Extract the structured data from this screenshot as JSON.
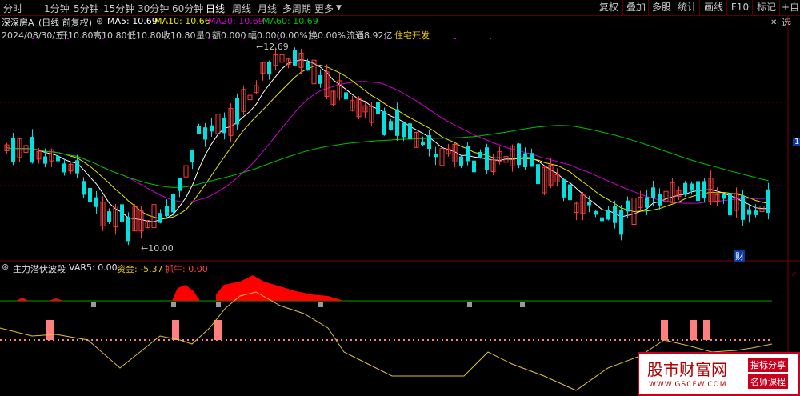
{
  "toolbar": {
    "periods": [
      "分时",
      "1分钟",
      "5分钟",
      "15分钟",
      "30分钟",
      "60分钟",
      "日线",
      "周线",
      "月线",
      "多周期",
      "更多"
    ],
    "active_period": "日线",
    "right_buttons": [
      "复权",
      "叠加",
      "多股",
      "统计",
      "画线",
      "F10",
      "标记"
    ],
    "extra_label": "+自选"
  },
  "stock": {
    "name": "深深房A",
    "mode": "(日线 前复权)",
    "date": "2024/08/30/五",
    "open": "开10.80",
    "high": "高10.80",
    "low": "低10.80",
    "close": "收10.80",
    "volume": "量0",
    "amount": "额0.000",
    "change": "幅0.00(0.00%)",
    "turnover": "换0.00%",
    "float": "流通8.92亿",
    "sector": "住宅开发"
  },
  "ma": {
    "ma5": "MA5: 10.69",
    "ma10": "MA10: 10.66",
    "ma20": "MA20: 10.69",
    "ma60": "MA60: 10.69"
  },
  "annotations": {
    "high_label": "12.69",
    "low_label": "10.00",
    "badge_small": "财",
    "side_marker": "1"
  },
  "indicator": {
    "name": "主力潜伏波段",
    "var5": "VAR5: 0.00",
    "fund": "资金: -5.37",
    "catch": "抓牛: 0.00"
  },
  "watermark": {
    "title": "股市财富网",
    "tag1": "指标分享",
    "tag2": "名师课程",
    "url": "WWW.GSCFW.COM"
  },
  "colors": {
    "up": "#ff3c3c",
    "down": "#00e0e0",
    "ma5": "#ffffff",
    "ma10": "#e6e600",
    "ma20": "#d000d0",
    "ma60": "#00c000",
    "fund_fill": "#ff0000",
    "fund_line": "#e0c040",
    "signal": "#ff7f7f"
  }
}
